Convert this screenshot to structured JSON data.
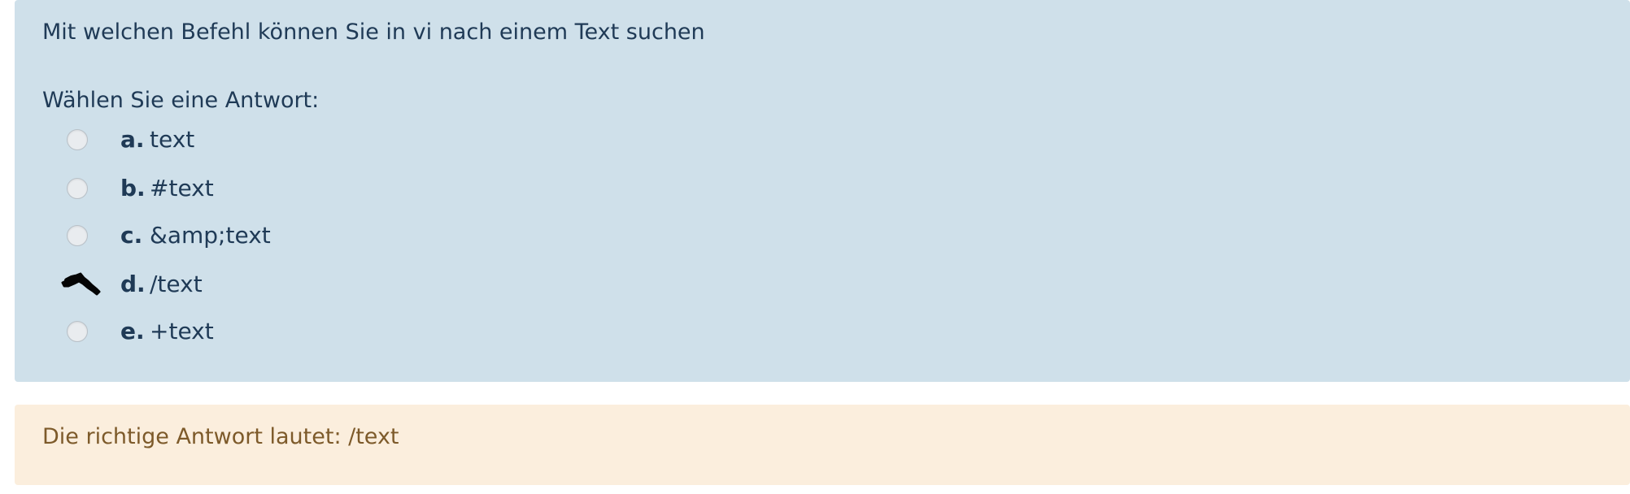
{
  "question": {
    "text": "Mit welchen Befehl können Sie in vi nach einem Text suchen",
    "prompt": "Wählen Sie eine Antwort:",
    "options": [
      {
        "letter": "a.",
        "text": "text",
        "selected": false
      },
      {
        "letter": "b.",
        "text": "#text",
        "selected": false
      },
      {
        "letter": "c.",
        "text": "&amp;text",
        "selected": false
      },
      {
        "letter": "d.",
        "text": "/text",
        "selected": true
      },
      {
        "letter": "e.",
        "text": "+text",
        "selected": false
      }
    ]
  },
  "feedback": {
    "text": "Die richtige Antwort lautet: /text"
  },
  "colors": {
    "question_background": "#cfe0ea",
    "question_text": "#1f3a56",
    "feedback_background": "#fbeedd",
    "feedback_text": "#7d5a2a"
  }
}
